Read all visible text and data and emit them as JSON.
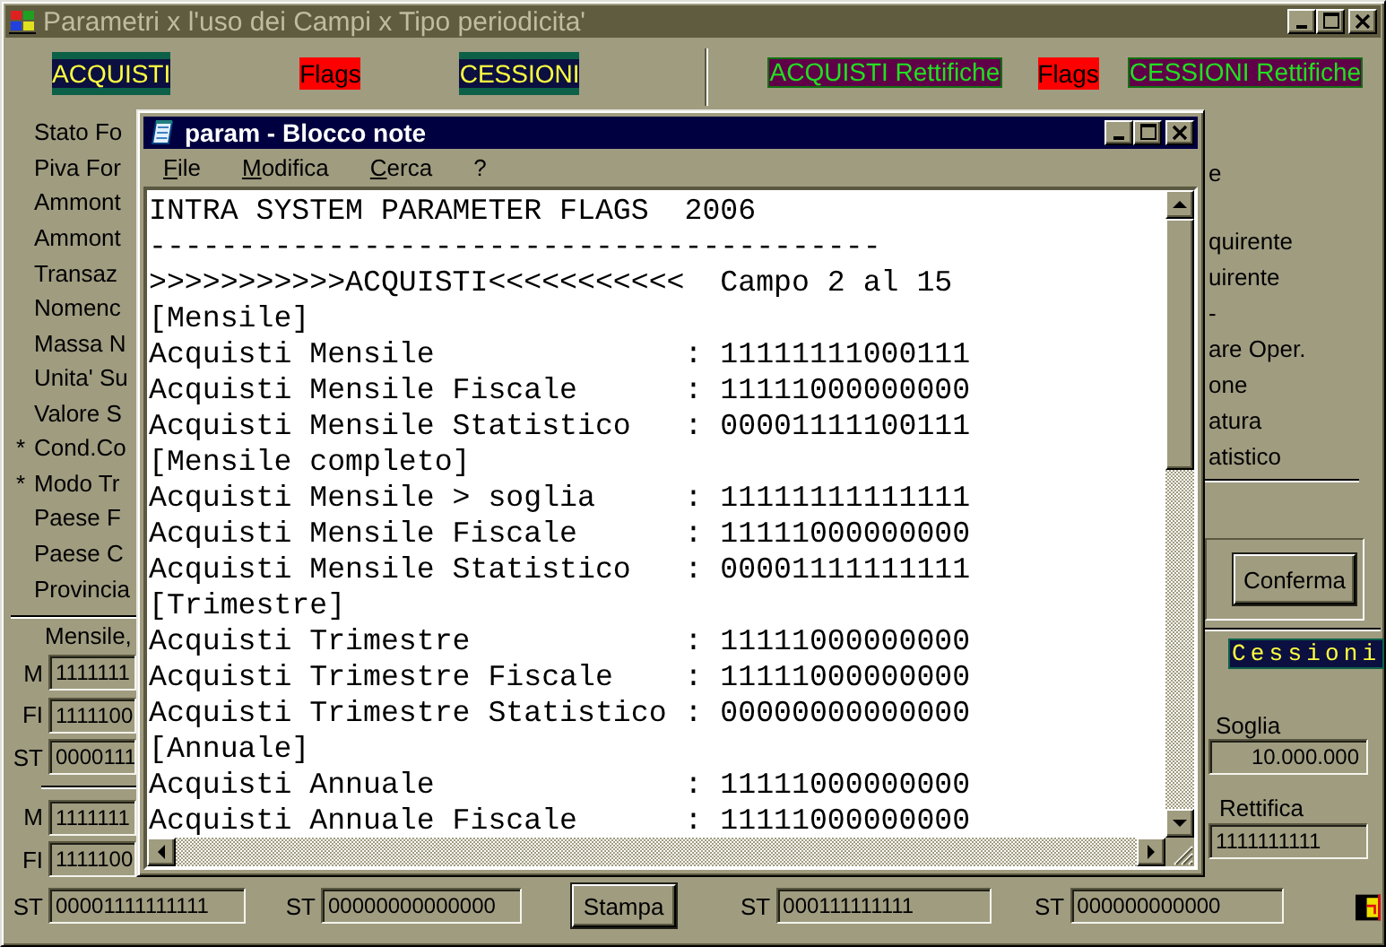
{
  "window": {
    "title": "Parametri x l'uso dei Campi x Tipo periodicita'"
  },
  "header_left": [
    {
      "text": "ACQUISTI",
      "kind": "section"
    },
    {
      "text": "Flags",
      "kind": "flag"
    },
    {
      "text": "CESSIONI",
      "kind": "section"
    }
  ],
  "header_right": [
    {
      "text": "ACQUISTI Rettifiche",
      "kind": "rettifica"
    },
    {
      "text": "Flags",
      "kind": "flag"
    },
    {
      "text": "CESSIONI Rettifiche",
      "kind": "rettifica"
    }
  ],
  "left_labels": [
    {
      "text": "Stato Fo"
    },
    {
      "text": "Piva For"
    },
    {
      "text": "Ammont"
    },
    {
      "text": "Ammont"
    },
    {
      "text": "Transaz"
    },
    {
      "text": "Nomenc"
    },
    {
      "text": "Massa N"
    },
    {
      "text": "Unita' Su"
    },
    {
      "text": "Valore S"
    },
    {
      "marker": "*",
      "text": "Cond.Co"
    },
    {
      "marker": "*",
      "text": "Modo Tr"
    },
    {
      "text": "Paese F"
    },
    {
      "text": "Paese C"
    },
    {
      "text": "Provincia"
    }
  ],
  "left_group": {
    "caption": "Mensile,",
    "fields": [
      {
        "prefix": "M",
        "value": "1111111"
      },
      {
        "prefix": "FI",
        "value": "1111100"
      },
      {
        "prefix": "ST",
        "value": "0000111"
      }
    ]
  },
  "left_group_2": {
    "fields": [
      {
        "prefix": "M",
        "value": "1111111"
      },
      {
        "prefix": "FI",
        "value": "1111100"
      }
    ]
  },
  "right_fragment": "e",
  "right_labels": [
    "quirente",
    "uirente",
    "-",
    "are Oper.",
    "one",
    "atura",
    "atistico"
  ],
  "confirm_button": "Conferma",
  "cessioni_label": "Cessioni",
  "soglia": {
    "label": "Soglia",
    "value": "10.000.000"
  },
  "rettifica": {
    "label": "Rettifica",
    "value": "1111111111"
  },
  "bottom_row": [
    {
      "kind": "field",
      "prefix": "ST",
      "value": "00001111111111"
    },
    {
      "kind": "field",
      "prefix": "ST",
      "value": "00000000000000"
    },
    {
      "kind": "button",
      "label": "Stampa"
    },
    {
      "kind": "field",
      "prefix": "ST",
      "value": "000111111111"
    },
    {
      "kind": "field",
      "prefix": "ST",
      "value": "000000000000"
    }
  ],
  "notepad": {
    "title": "param - Blocco note",
    "menu": [
      "File",
      "Modifica",
      "Cerca",
      "?"
    ],
    "lines": [
      "INTRA SYSTEM PARAMETER FLAGS  2006",
      "-----------------------------------------",
      ">>>>>>>>>>>ACQUISTI<<<<<<<<<<<  Campo 2 al 15",
      "[Mensile]",
      "Acquisti Mensile              : 11111111000111",
      "Acquisti Mensile Fiscale      : 11111000000000",
      "Acquisti Mensile Statistico   : 00001111100111",
      "[Mensile completo]",
      "Acquisti Mensile > soglia     : 11111111111111",
      "Acquisti Mensile Fiscale      : 11111000000000",
      "Acquisti Mensile Statistico   : 00001111111111",
      "[Trimestre]",
      "Acquisti Trimestre            : 11111000000000",
      "Acquisti Trimestre Fiscale    : 11111000000000",
      "Acquisti Trimestre Statistico : 00000000000000",
      "[Annuale]",
      "Acquisti Annuale              : 11111000000000",
      "Acquisti Annuale Fiscale      : 11111000000000"
    ]
  }
}
